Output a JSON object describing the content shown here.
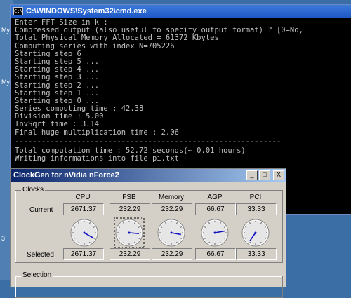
{
  "desktop": {
    "labels": [
      "My",
      "My",
      "3"
    ]
  },
  "cmd": {
    "title": "C:\\WINDOWS\\System32\\cmd.exe",
    "icon_text": "C:\\",
    "lines": [
      "Enter FFT Size in k :",
      "Compressed output (also useful to specify output format) ? [0=No,",
      "Total Physical Memory Allocated = 61372 Kbytes",
      "Computing series with index N=705226",
      "Starting step 6",
      "Starting step 5 ...",
      "Starting step 4 ...",
      "Starting step 3 ...",
      "Starting step 2 ...",
      "Starting step 1 ...",
      "Starting step 0 ...",
      "Series computing time : 42.38",
      "Division time : 5.00",
      "InvSqrt time : 3.14",
      "Final huge multiplication time : 2.06"
    ],
    "separator": "------------------------------------------------------------",
    "lines_after": [
      "Total computation time : 52.72 seconds(~ 0.01 hours)",
      "Writing informations into file pi.txt"
    ]
  },
  "clockgen": {
    "title": "ClockGen for nVidia nForce2",
    "buttons": {
      "minimize": "_",
      "maximize": "□",
      "close": "X"
    },
    "clocks_legend": "Clocks",
    "selection_legend": "Selection",
    "row_current": "Current",
    "row_selected": "Selected",
    "columns": [
      {
        "name": "CPU",
        "current": "2671.37",
        "selected": "2671.37",
        "hand_angle": 120
      },
      {
        "name": "FSB",
        "current": "232.29",
        "selected": "232.29",
        "hand_angle": 95
      },
      {
        "name": "Memory",
        "current": "232.29",
        "selected": "232.29",
        "hand_angle": 100
      },
      {
        "name": "AGP",
        "current": "66.67",
        "selected": "66.67",
        "hand_angle": 80
      },
      {
        "name": "PCI",
        "current": "33.33",
        "selected": "33.33",
        "hand_angle": 215
      }
    ]
  }
}
